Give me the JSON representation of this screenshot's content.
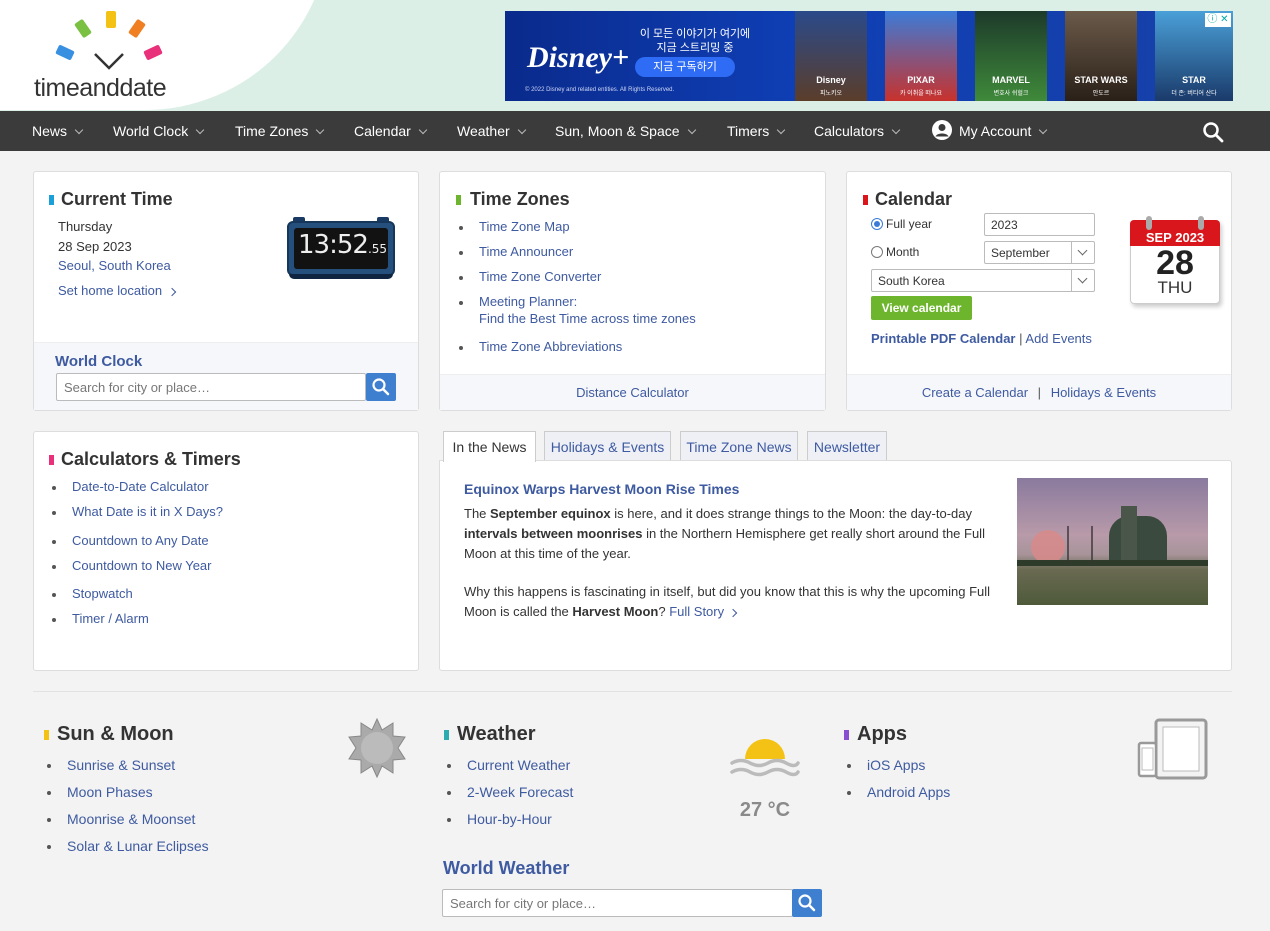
{
  "header": {
    "logo_text": "timeanddate",
    "ad": {
      "brand": "Disney+",
      "line1": "이 모든 이야기가 여기에",
      "line2": "지금 스트리밍 중",
      "cta": "지금 구독하기",
      "legal": "© 2022 Disney and related entities. All Rights Reserved.",
      "tiles": [
        {
          "label": "Disney",
          "sub": "피노키오"
        },
        {
          "label": "PIXAR",
          "sub": "카 이취을 떠나요"
        },
        {
          "label": "MARVEL",
          "sub": "변호사 쉬헐크"
        },
        {
          "label": "STAR WARS",
          "sub": "안도르"
        },
        {
          "label": "STAR",
          "sub": "더 존: 버티어 산다"
        }
      ],
      "close": "ⓘ ✕"
    }
  },
  "nav": {
    "items": [
      "News",
      "World Clock",
      "Time Zones",
      "Calendar",
      "Weather",
      "Sun, Moon & Space",
      "Timers",
      "Calculators",
      "My Account"
    ]
  },
  "current_time": {
    "title": "Current Time",
    "day": "Thursday",
    "date": "28 Sep 2023",
    "location": "Seoul, South Korea",
    "set_home": "Set home location",
    "clock_time": "13:52",
    "clock_seconds": "55",
    "world_clock_title": "World Clock",
    "search_placeholder": "Search for city or place…"
  },
  "time_zones": {
    "title": "Time Zones",
    "links": [
      "Time Zone Map",
      "Time Announcer",
      "Time Zone Converter",
      "Meeting Planner:",
      "Find the Best Time across time zones",
      "Time Zone Abbreviations"
    ],
    "footer_link": "Distance Calculator"
  },
  "calendar": {
    "title": "Calendar",
    "full_year_label": "Full year",
    "year_value": "2023",
    "month_label": "Month",
    "month_value": "September",
    "country_value": "South Korea",
    "view_button": "View calendar",
    "printable": "Printable PDF Calendar",
    "separator": "|",
    "add_events": "Add Events",
    "icon_month": "SEP",
    "icon_year": "2023",
    "icon_day": "28",
    "icon_weekday": "THU",
    "footer_create": "Create a Calendar",
    "footer_sep": "|",
    "footer_holidays": "Holidays & Events"
  },
  "calculators": {
    "title": "Calculators & Timers",
    "links": [
      "Date-to-Date Calculator",
      "What Date is it in X Days?",
      "Countdown to Any Date",
      "Countdown to New Year",
      "Stopwatch",
      "Timer / Alarm"
    ]
  },
  "news": {
    "tabs": [
      "In the News",
      "Holidays & Events",
      "Time Zone News",
      "Newsletter"
    ],
    "headline": "Equinox Warps Harvest Moon Rise Times",
    "p1_a": "The ",
    "p1_b": "September equinox",
    "p1_c": " is here, and it does strange things to the Moon: the day-to-day ",
    "p1_d": "intervals between moonrises",
    "p1_e": " in the Northern Hemisphere get really short around the Full Moon at this time of the year.",
    "p2_a": "Why this happens is fascinating in itself, but did you know that this is why the upcoming Full Moon is called the ",
    "p2_b": "Harvest Moon",
    "p2_c": "? ",
    "full_story": "Full Story"
  },
  "sun_moon": {
    "title": "Sun & Moon",
    "links": [
      "Sunrise & Sunset",
      "Moon Phases",
      "Moonrise & Moonset",
      "Solar & Lunar Eclipses"
    ]
  },
  "weather": {
    "title": "Weather",
    "links": [
      "Current Weather",
      "2-Week Forecast",
      "Hour-by-Hour"
    ],
    "temperature": "27 °C",
    "world_weather_title": "World Weather",
    "search_placeholder": "Search for city or place…"
  },
  "apps": {
    "title": "Apps",
    "links": [
      "iOS Apps",
      "Android Apps"
    ]
  },
  "colors": {
    "nav_bg": "#3b3b3b",
    "link": "#3e5aa0",
    "accent_green": "#6cb52d",
    "search_blue": "#3e7fd0"
  }
}
